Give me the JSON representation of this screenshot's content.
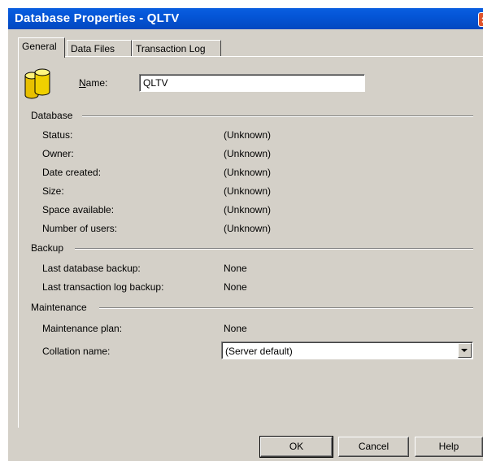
{
  "window": {
    "title": "Database Properties - QLTV",
    "close_symbol": "×"
  },
  "tabs": [
    {
      "label": "General",
      "active": true
    },
    {
      "label": "Data Files",
      "active": false
    },
    {
      "label": "Transaction Log",
      "active": false
    }
  ],
  "general": {
    "name_label_first": "N",
    "name_label_rest": "ame:",
    "name_value": "QLTV",
    "icon": "database-cylinders-icon"
  },
  "database": {
    "heading": "Database",
    "rows": [
      {
        "label": "Status:",
        "value": "(Unknown)"
      },
      {
        "label": "Owner:",
        "value": "(Unknown)"
      },
      {
        "label": "Date created:",
        "value": "(Unknown)"
      },
      {
        "label": "Size:",
        "value": "(Unknown)"
      },
      {
        "label": "Space available:",
        "value": "(Unknown)"
      },
      {
        "label": "Number of users:",
        "value": "(Unknown)"
      }
    ]
  },
  "backup": {
    "heading": "Backup",
    "rows": [
      {
        "label": "Last database backup:",
        "value": "None"
      },
      {
        "label": "Last transaction log backup:",
        "value": "None"
      }
    ]
  },
  "maintenance": {
    "heading": "Maintenance",
    "plan_label": "Maintenance plan:",
    "plan_value": "None",
    "collation_label": "Collation name:",
    "collation_value": "(Server default)"
  },
  "buttons": {
    "ok": "OK",
    "cancel": "Cancel",
    "help": "Help"
  },
  "colors": {
    "titlebar": "#0455d6",
    "dialog_bg": "#d4d0c8",
    "close": "#e0542c"
  }
}
